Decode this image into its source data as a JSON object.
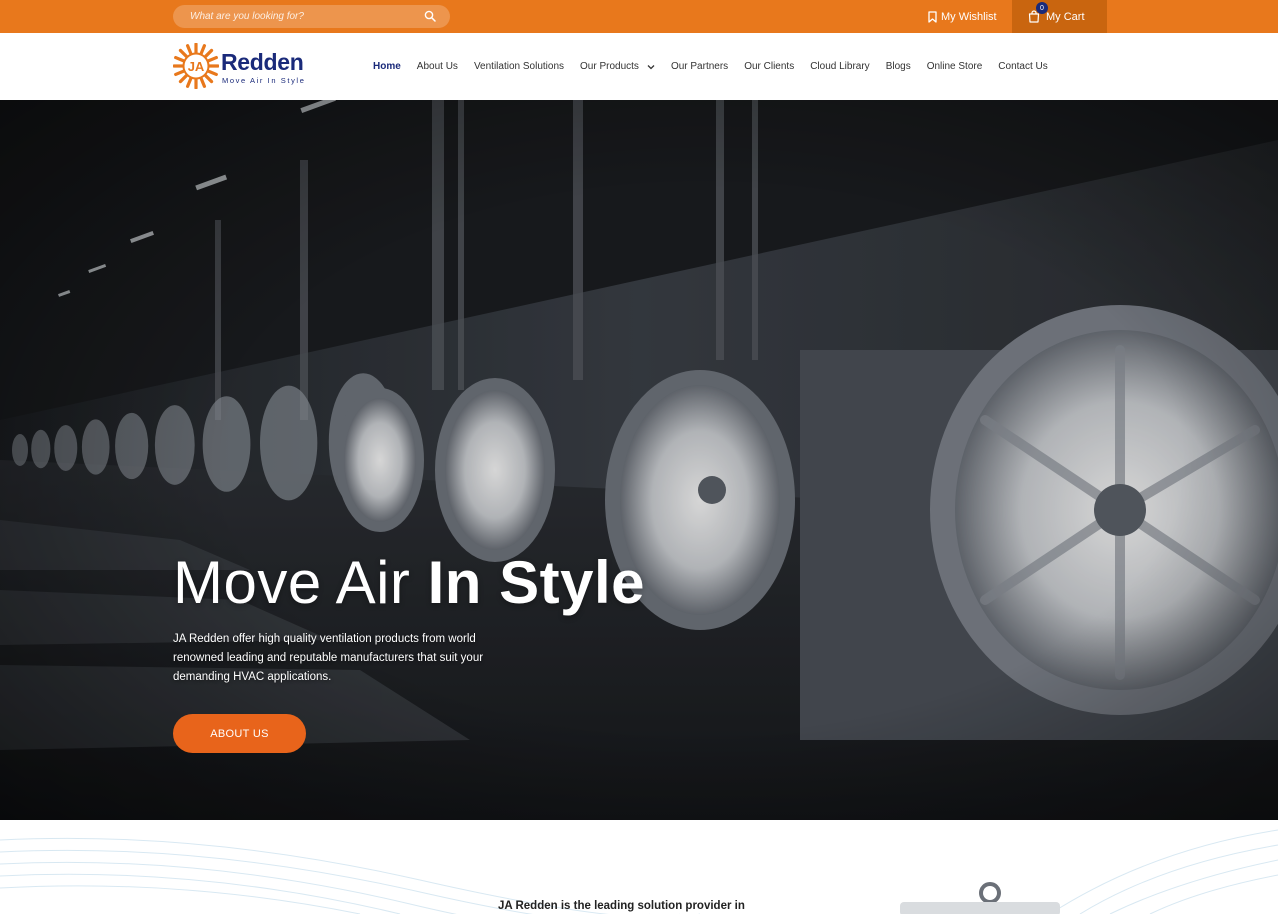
{
  "topbar": {
    "search_placeholder": "What are you looking for?",
    "wishlist_label": "My Wishlist",
    "cart_label": "My Cart",
    "cart_count": "0",
    "bg_color": "#e8781c"
  },
  "logo": {
    "mark_text": "JA",
    "brand": "Redden",
    "tagline": "Move Air In Style"
  },
  "nav": {
    "items": [
      {
        "label": "Home"
      },
      {
        "label": "About Us"
      },
      {
        "label": "Ventilation Solutions"
      },
      {
        "label": "Our Products"
      },
      {
        "label": "Our Partners"
      },
      {
        "label": "Our Clients"
      },
      {
        "label": "Cloud Library"
      },
      {
        "label": "Blogs"
      },
      {
        "label": "Online Store"
      },
      {
        "label": "Contact Us"
      }
    ]
  },
  "hero": {
    "title_light": "Move Air ",
    "title_bold": "In Style",
    "description": "JA Redden offer high quality ventilation products from world renowned leading and reputable manufacturers that suit your demanding HVAC applications.",
    "cta_label": "ABOUT US",
    "cta_color": "#e8641b"
  },
  "below": {
    "lead_text": "JA Redden is the leading solution provider in"
  }
}
